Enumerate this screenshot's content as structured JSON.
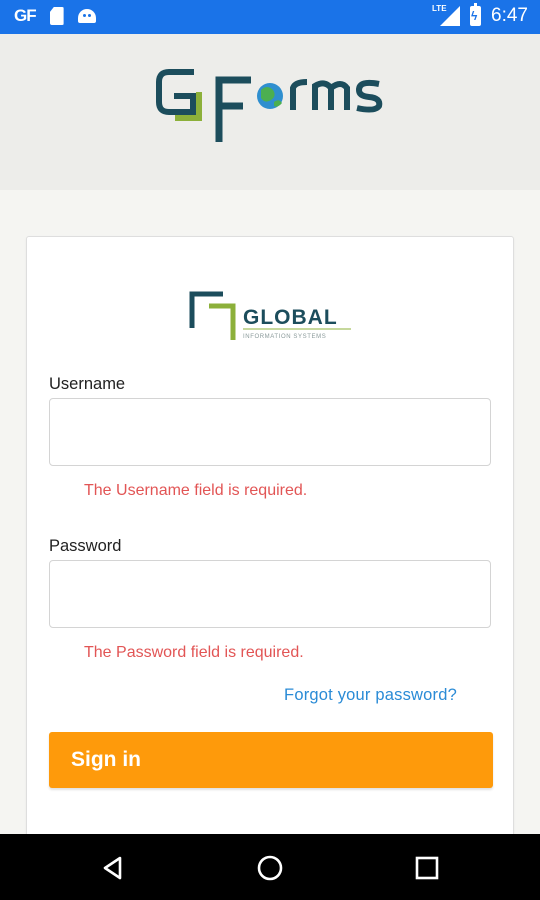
{
  "status_bar": {
    "notification_app": "GF",
    "network": "LTE",
    "time": "6:47",
    "background_color": "#1a73e8"
  },
  "header": {
    "logo_text": "GFORMS",
    "background_color": "#ededea"
  },
  "login_card": {
    "brand_logo": {
      "name": "GLOBAL",
      "tagline": "INFORMATION SYSTEMS"
    },
    "username": {
      "label": "Username",
      "value": "",
      "placeholder": "",
      "error": "The Username field is required."
    },
    "password": {
      "label": "Password",
      "value": "",
      "placeholder": "",
      "error": "The Password field is required."
    },
    "forgot_password_label": "Forgot your password?",
    "sign_in_label": "Sign in",
    "colors": {
      "accent": "#fe9a0b",
      "error": "#e25555",
      "link": "#2a8bd6"
    }
  },
  "nav_bar": {
    "buttons": [
      "back-icon",
      "home-icon",
      "recents-icon"
    ]
  }
}
